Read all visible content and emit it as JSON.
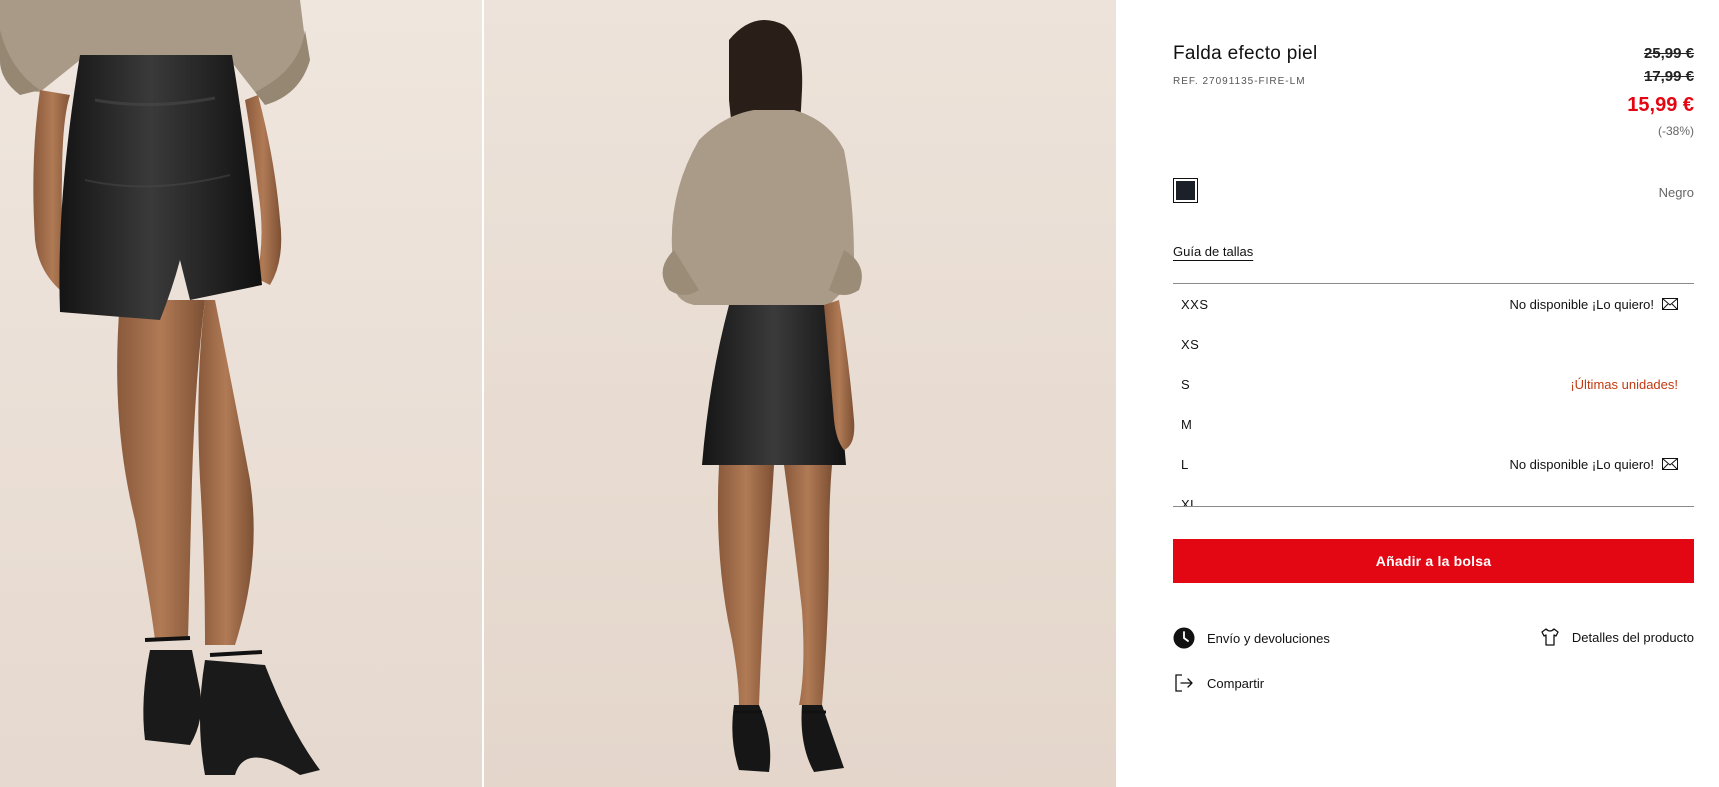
{
  "product": {
    "title": "Falda efecto piel",
    "reference": "REF. 27091135-FIRE-LM",
    "prices": {
      "original": "25,99 €",
      "previous": "17,99 €",
      "current": "15,99 €",
      "discount": "(-38%)"
    },
    "color": {
      "name": "Negro",
      "swatch": "#1c2028"
    }
  },
  "size_guide_label": "Guía de tallas",
  "sizes": [
    {
      "label": "XXS",
      "status": "No disponible ¡Lo quiero!",
      "icon": "mail-icon"
    },
    {
      "label": "XS",
      "status": ""
    },
    {
      "label": "S",
      "status": "¡Últimas unidades!"
    },
    {
      "label": "M",
      "status": ""
    },
    {
      "label": "L",
      "status": "No disponible ¡Lo quiero!",
      "icon": "mail-icon"
    },
    {
      "label": "XL",
      "status": ""
    }
  ],
  "actions": {
    "add_to_bag": "Añadir a la bolsa",
    "shipping": "Envío y devoluciones",
    "details": "Detalles del producto",
    "share": "Compartir"
  },
  "colors": {
    "accent": "#e30613",
    "last_units": "#c23a10",
    "photo_bg": "#ece2da"
  }
}
